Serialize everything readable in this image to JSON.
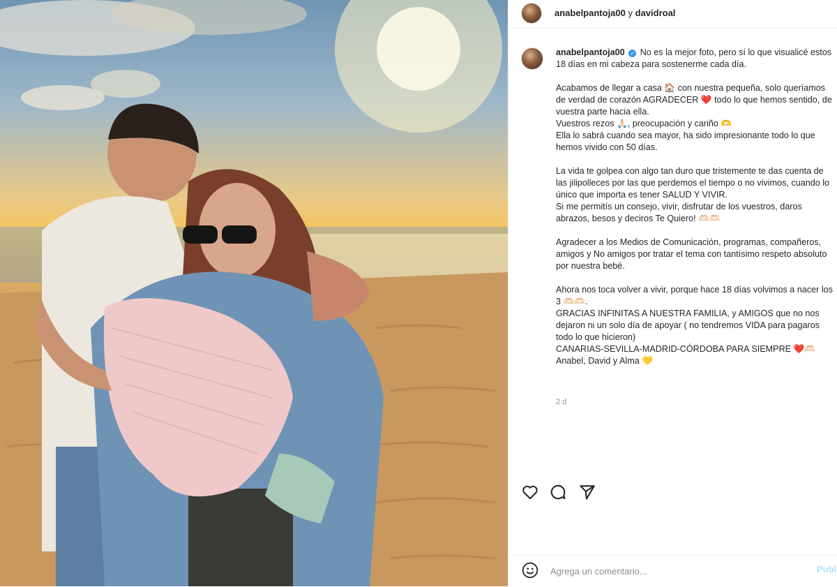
{
  "header": {
    "user1": "anabelpantoja00",
    "joiner": "y",
    "user2": "davidroal"
  },
  "post": {
    "author": "anabelpantoja00",
    "verified_mark": "✓",
    "paragraphs": [
      "No es la mejor foto, pero sí lo que visualicé estos 18 días en mi cabeza para sostenerme cada día.",
      "Acabamos de llegar a casa 🏠 con nuestra pequeña, solo queríamos de verdad de corazón AGRADECER ❤️ todo lo que hemos sentido, de vuestra parte hacia ella.\nVuestros rezos 🙏🏻, preocupación y cariño 🫶\nElla lo sabrá cuando sea mayor, ha sido impresionante todo lo que hemos vivido con 50 días.",
      "La vida te golpea con algo tan duro que tristemente te das cuenta de las jilipolleces por las que perdemos el tiempo o no vivimos, cuando lo único que importa es tener SALUD Y VIVIR.\nSi me permitís un consejo, vivir, disfrutar de los vuestros, daros abrazos, besos y deciros Te Quiero! 🫶🏻🫶🏻",
      "Agradecer a los Medios de Comunicación, programas, compañeros, amigos y No amigos por tratar el tema con tantísimo respeto absoluto por nuestra bebé.",
      "Ahora nos toca volver a vivir, porque hace 18 días volvimos a nacer los 3 🫶🏻🫶🏻.\nGRACIAS INFINITAS A NUESTRA FAMILIA, y AMIGOS que no nos dejaron ni un solo día de apoyar ( no tendremos VIDA para pagaros todo lo que hicieron)\nCANARIAS-SEVILLA-MADRID-CÓRDOBA PARA SIEMPRE ❤️🫶🏻\nAnabel, David y Alma 💛"
    ],
    "time_ago": "2 d"
  },
  "actions": {
    "like_icon": "heart-icon",
    "comment_icon": "comment-icon",
    "share_icon": "share-icon"
  },
  "comment": {
    "placeholder": "Agrega un comentario...",
    "publish_label": "Publicar"
  }
}
